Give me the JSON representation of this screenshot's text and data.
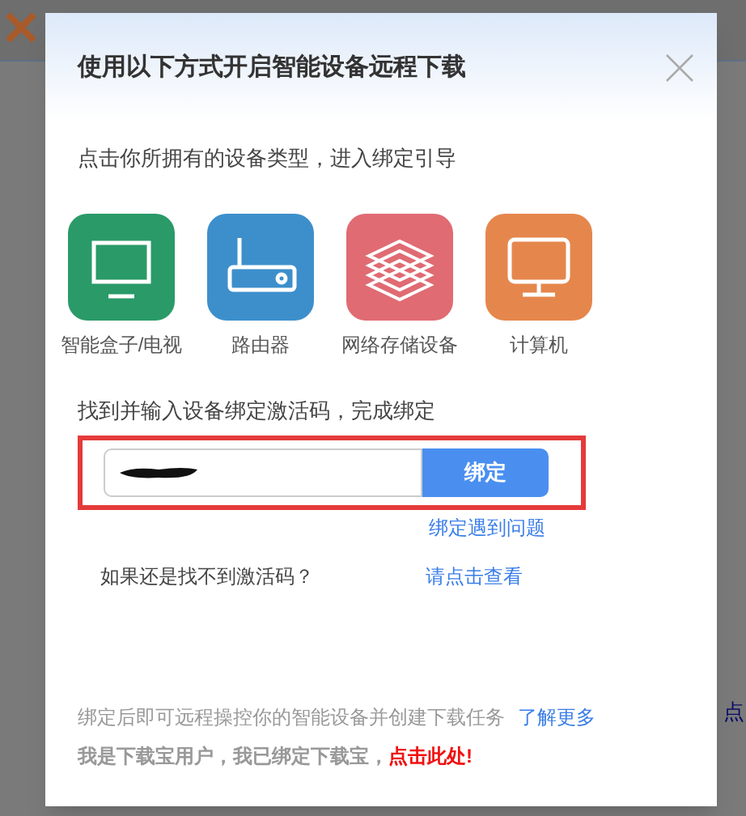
{
  "background": {
    "side_text": "点"
  },
  "dialog": {
    "title": "使用以下方式开启智能设备远程下载",
    "intro": "点击你所拥有的设备类型，进入绑定引导",
    "devices": [
      {
        "kind": "tv",
        "label": "智能盒子/电视",
        "color": "#2a9a68"
      },
      {
        "kind": "router",
        "label": "路由器",
        "color": "#3d8fcb"
      },
      {
        "kind": "storage",
        "label": "网络存储设备",
        "color": "#e06b73"
      },
      {
        "kind": "computer",
        "label": "计算机",
        "color": "#e5874d"
      }
    ],
    "bind_prompt": "找到并输入设备绑定激活码，完成绑定",
    "bind_button": "绑定",
    "help_link": "绑定遇到问题",
    "not_found_text": "如果还是找不到激活码？",
    "not_found_link": "请点击查看",
    "footer_text": "绑定后即可远程操控你的智能设备并创建下载任务",
    "footer_link": "了解更多",
    "bound_text": "我是下载宝用户，我已绑定下载宝，",
    "bound_link": "点击此处!"
  }
}
